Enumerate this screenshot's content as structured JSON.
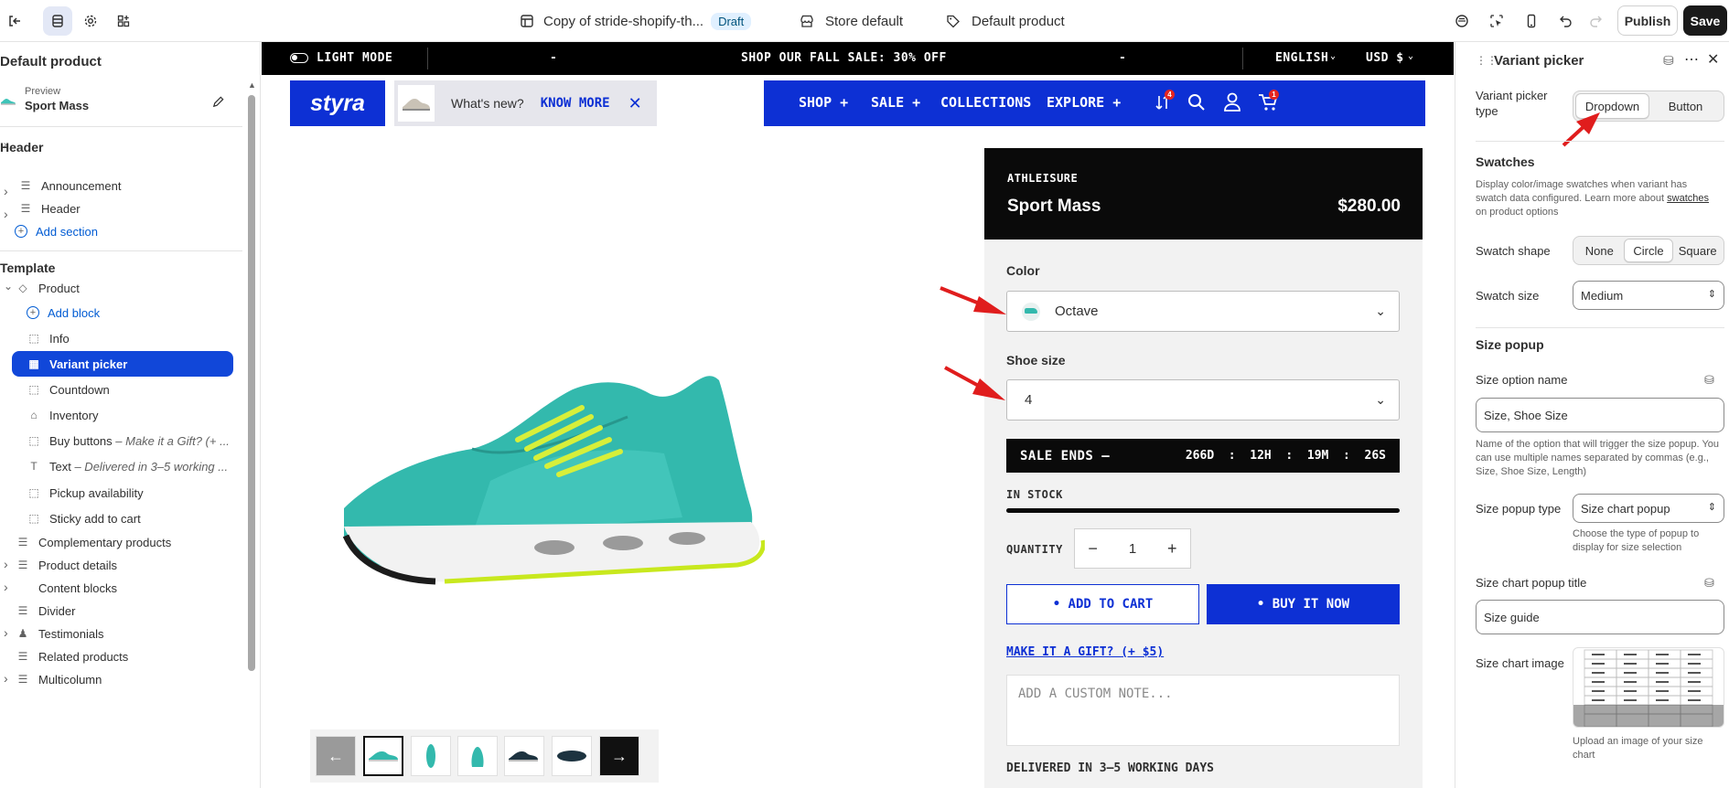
{
  "topbar": {
    "theme_name": "Copy of stride-shopify-th...",
    "status": "Draft",
    "store": "Store default",
    "template": "Default product",
    "publish": "Publish",
    "save": "Save"
  },
  "left": {
    "title": "Default product",
    "preview_label": "Preview",
    "preview_value": "Sport Mass",
    "header_section": "Header",
    "template_section": "Template",
    "items": [
      {
        "label": "Announcement"
      },
      {
        "label": "Header"
      },
      {
        "label": "Add section"
      },
      {
        "label": "Product"
      },
      {
        "label": "Add block"
      },
      {
        "label": "Info"
      },
      {
        "label": "Variant picker"
      },
      {
        "label": "Countdown"
      },
      {
        "label": "Inventory"
      },
      {
        "label": "Buy buttons",
        "sub": "– Make it a Gift? (+ ..."
      },
      {
        "label": "Text",
        "sub": "– Delivered in 3–5 working ..."
      },
      {
        "label": "Pickup availability"
      },
      {
        "label": "Sticky add to cart"
      },
      {
        "label": "Complementary products"
      },
      {
        "label": "Product details"
      },
      {
        "label": "Content blocks"
      },
      {
        "label": "Divider"
      },
      {
        "label": "Testimonials"
      },
      {
        "label": "Related products"
      },
      {
        "label": "Multicolumn"
      }
    ]
  },
  "site": {
    "light_mode": "LIGHT MODE",
    "dash1": "-",
    "announcement": "SHOP OUR FALL SALE: 30% OFF",
    "dash2": "-",
    "language": "ENGLISH",
    "currency": "USD $",
    "logo": "styra",
    "whats_new": "What's new?",
    "know_more": "KNOW MORE",
    "nav": [
      "SHOP +",
      "SALE +",
      "COLLECTIONS",
      "EXPLORE +"
    ],
    "compare_badge": "4",
    "cart_badge": "1",
    "vendor": "ATHLEISURE",
    "product_title": "Sport Mass",
    "price": "$280.00",
    "color_label": "Color",
    "color_value": "Octave",
    "size_label": "Shoe size",
    "size_value": "4",
    "sale_ends": "SALE ENDS –",
    "countdown": "266D  :  12H  :  19M  :  26S",
    "stock": "IN STOCK",
    "stock_level": 1.0,
    "quantity_label": "QUANTITY",
    "quantity": "1",
    "add_to_cart": "• ADD TO CART",
    "buy_now": "• BUY IT NOW",
    "gift_link": "MAKE IT A GIFT? (+ $5)",
    "note_placeholder": "ADD A CUSTOM NOTE...",
    "delivery": "DELIVERED IN 3–5 WORKING DAYS"
  },
  "right": {
    "title": "Variant picker",
    "picker_type_label": "Variant picker type",
    "picker_options": [
      "Dropdown",
      "Button"
    ],
    "swatches_title": "Swatches",
    "swatches_help_1": "Display color/image swatches when variant has swatch data configured. Learn more about",
    "swatches_help_link": "swatches",
    "swatches_help_2": "on product options",
    "swatch_shape_label": "Swatch shape",
    "swatch_shapes": [
      "None",
      "Circle",
      "Square"
    ],
    "swatch_size_label": "Swatch size",
    "swatch_size_value": "Medium",
    "size_popup_title": "Size popup",
    "size_option_name_label": "Size option name",
    "size_option_name_value": "Size, Shoe Size",
    "size_option_help": "Name of the option that will trigger the size popup. You can use multiple names separated by commas (e.g., Size, Shoe Size, Length)",
    "popup_type_label": "Size popup type",
    "popup_type_value": "Size chart popup",
    "popup_type_help": "Choose the type of popup to display for size selection",
    "popup_title_label": "Size chart popup title",
    "popup_title_value": "Size guide",
    "chart_image_label": "Size chart image",
    "chart_image_help": "Upload an image of your size chart"
  }
}
